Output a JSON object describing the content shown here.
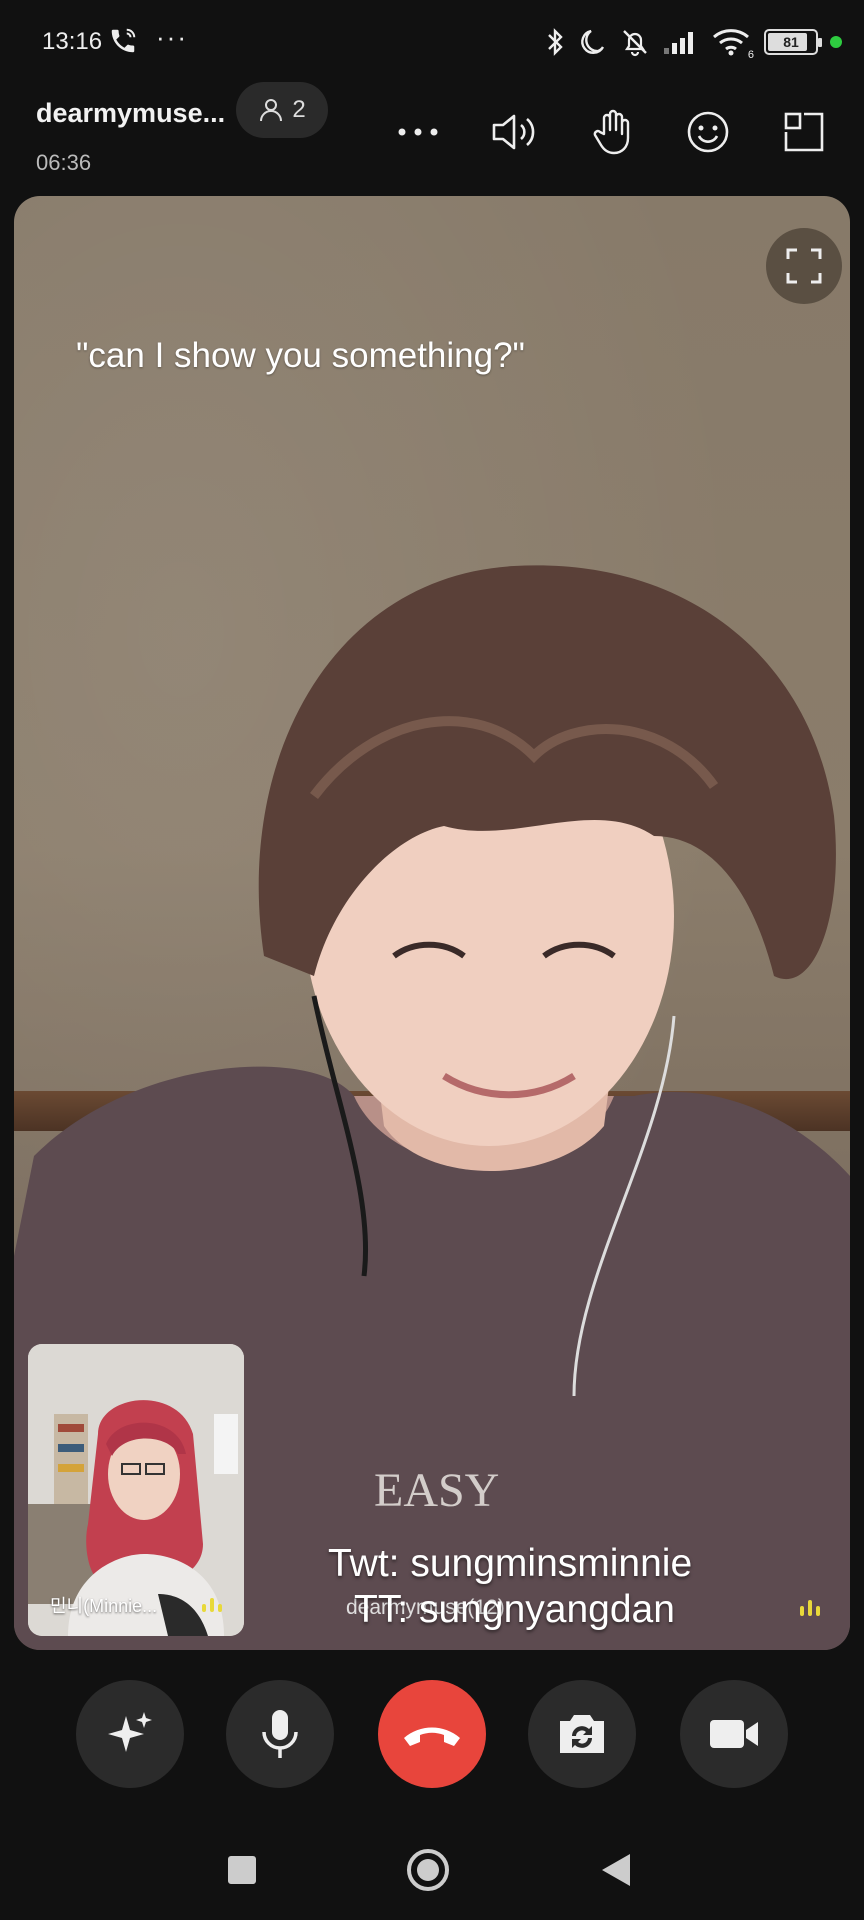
{
  "status_bar": {
    "time": "13:16",
    "overflow": "···",
    "network_type": "6",
    "battery_level": "81"
  },
  "header": {
    "call_name": "dearmymuse...",
    "participant_count": "2",
    "call_duration": "06:36"
  },
  "video": {
    "caption": "\"can I show you something?\"",
    "handle_twitter": "Twt: sungminsminnie",
    "handle_tiktok": "TT: sungnyangdan",
    "remote_label": "dearmymuse(12)",
    "self_label": "민니(Minnie..."
  },
  "controls": {
    "effects": "sparkle-icon",
    "mic": "microphone-icon",
    "end_call": "end-call-icon",
    "flip_camera": "flip-camera-icon",
    "video": "video-camera-icon"
  },
  "colors": {
    "end_call": "#e8453c",
    "control_bg": "#2b2b2b",
    "audio_indicator": "#e8d93a",
    "online_dot": "#2ecc40"
  }
}
